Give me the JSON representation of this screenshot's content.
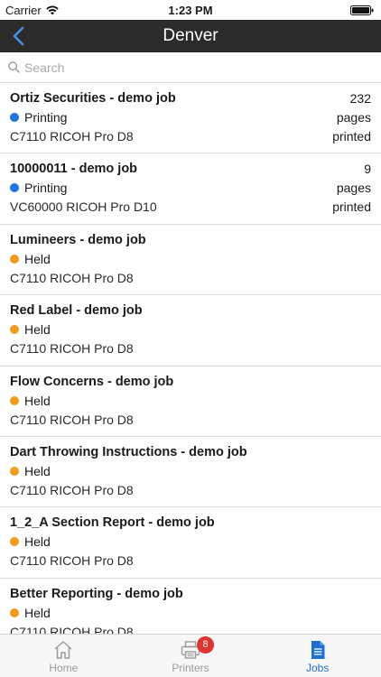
{
  "status_bar": {
    "carrier": "Carrier",
    "time": "1:23 PM"
  },
  "nav": {
    "title": "Denver",
    "back_icon": "chevron-left-icon"
  },
  "search": {
    "placeholder": "Search",
    "value": ""
  },
  "colors": {
    "printing": "#1e74e0",
    "held": "#f39b1a",
    "nav_bg": "#2b2b2b",
    "accent": "#1f6fd1",
    "badge": "#e2322c"
  },
  "jobs": [
    {
      "name": "Ortiz Securities - demo job",
      "status": "Printing",
      "status_color": "#1e74e0",
      "printer": "C7110 RICOH Pro D8",
      "count": "232",
      "pages_label": "pages",
      "printed_label": "printed"
    },
    {
      "name": "10000011 - demo job",
      "status": "Printing",
      "status_color": "#1e74e0",
      "printer": "VC60000 RICOH Pro D10",
      "count": "9",
      "pages_label": "pages",
      "printed_label": "printed"
    },
    {
      "name": "Lumineers - demo job",
      "status": "Held",
      "status_color": "#f39b1a",
      "printer": "C7110 RICOH Pro D8"
    },
    {
      "name": "Red Label - demo job",
      "status": "Held",
      "status_color": "#f39b1a",
      "printer": "C7110 RICOH Pro D8"
    },
    {
      "name": "Flow Concerns - demo job",
      "status": "Held",
      "status_color": "#f39b1a",
      "printer": "C7110 RICOH Pro D8"
    },
    {
      "name": "Dart Throwing Instructions - demo job",
      "status": "Held",
      "status_color": "#f39b1a",
      "printer": "C7110 RICOH Pro D8"
    },
    {
      "name": "1_2_A Section Report - demo job",
      "status": "Held",
      "status_color": "#f39b1a",
      "printer": "C7110 RICOH Pro D8"
    },
    {
      "name": "Better Reporting - demo job",
      "status": "Held",
      "status_color": "#f39b1a",
      "printer": "C7110 RICOH Pro D8"
    }
  ],
  "tabs": [
    {
      "label": "Home",
      "icon": "home-icon",
      "active": false
    },
    {
      "label": "Printers",
      "icon": "printer-icon",
      "active": false,
      "badge": "8"
    },
    {
      "label": "Jobs",
      "icon": "document-icon",
      "active": true
    }
  ]
}
